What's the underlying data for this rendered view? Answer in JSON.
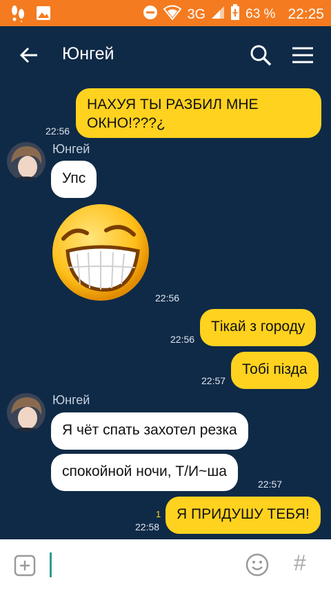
{
  "status_bar": {
    "battery": "63 %",
    "network": "3G",
    "time": "22:25",
    "icons": [
      "footprints-icon",
      "image-icon",
      "do-not-disturb-icon",
      "wifi-icon",
      "signal-icon",
      "battery-icon"
    ]
  },
  "header": {
    "title": "Юнгей",
    "back_icon": "arrow-left-icon",
    "search_icon": "search-icon",
    "menu_icon": "hamburger-menu-icon"
  },
  "messages": [
    {
      "direction": "out",
      "text": "НАХУЯ ТЫ РАЗБИЛ МНЕ ОКНО!???¿",
      "time": "22:56"
    },
    {
      "direction": "in",
      "sender": "Юнгей",
      "text": "Упс"
    },
    {
      "direction": "in",
      "sticker": "laughing-face-sticker",
      "time": "22:56"
    },
    {
      "direction": "out",
      "text": "Тікай з городу",
      "time": "22:56"
    },
    {
      "direction": "out",
      "text": "Тобі пізда",
      "time": "22:57"
    },
    {
      "direction": "in",
      "sender": "Юнгей",
      "text": "Я чёт спать захотел резка"
    },
    {
      "direction": "in",
      "text": "спокойной ночи, Т/И~ша",
      "time": "22:57"
    },
    {
      "direction": "out",
      "text": "Я ПРИДУШУ ТЕБЯ!",
      "time": "22:58",
      "read_count": "1"
    }
  ],
  "input_bar": {
    "add_icon": "plus-square-icon",
    "emoji_icon": "smiley-icon",
    "hash_label": "#"
  },
  "colors": {
    "status_bar": "#f47b20",
    "background": "#0f2a47",
    "outgoing_bubble": "#ffd21f",
    "incoming_bubble": "#ffffff",
    "caret": "#2c9a8f"
  }
}
